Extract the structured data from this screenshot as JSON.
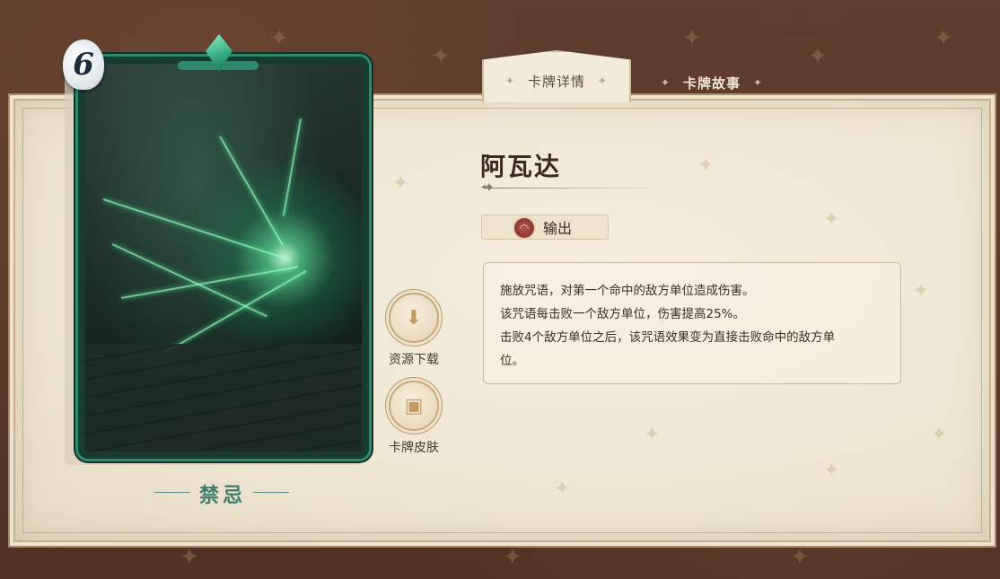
{
  "card": {
    "cost": "6",
    "rarity": "禁忌",
    "art_icon": "green-lightning-curse-art"
  },
  "tabs": [
    {
      "label": "卡牌详情",
      "active": true
    },
    {
      "label": "卡牌故事",
      "active": false
    }
  ],
  "side_buttons": [
    {
      "label": "资源下载",
      "icon": "money-bag-download-icon"
    },
    {
      "label": "卡牌皮肤",
      "icon": "card-skin-icon"
    }
  ],
  "detail": {
    "name": "阿瓦达",
    "role": {
      "label": "输出",
      "icon": "damage-role-icon",
      "color": "#8a2f2a"
    },
    "description": [
      "施放咒语，对第一个命中的敌方单位造成伤害。",
      "该咒语每击败一个敌方单位，伤害提高25%。",
      "击败4个敌方单位之后，该咒语效果变为直接击败命中的敌方单",
      "位。"
    ]
  },
  "colors": {
    "background": "#5a3a2a",
    "parchment": "#f1e8d6",
    "card_border": "#2f8a6d",
    "rarity_text": "#3f7d6a"
  }
}
